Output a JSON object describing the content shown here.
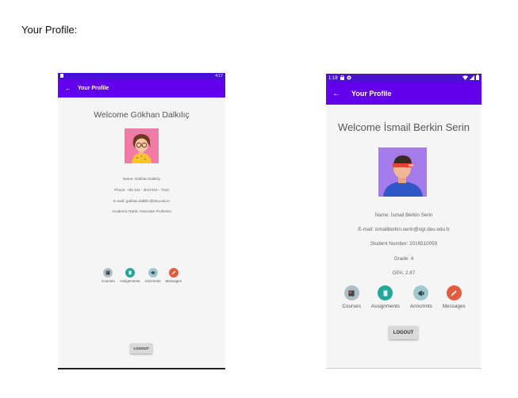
{
  "page": {
    "heading": "Your Profile:"
  },
  "phone1": {
    "status": {
      "left_icon": "sim-icon",
      "time": "4:17"
    },
    "appbar": {
      "back": "←",
      "title": "Your Profile"
    },
    "welcome": "Welcome Gökhan Dalkılıç",
    "avatar": {
      "name": "teacher-avatar",
      "bg": "#f17aa6"
    },
    "info": [
      "Name: Gökhan Dalkılıç",
      "Phone: +90 232 - 3017410 - 7410",
      "E-mail: gokhan.dalkilic@deu.edu.tr",
      "Academic Rank: Associate Professor"
    ],
    "nav": [
      {
        "label": "Courses",
        "icon": "courses-icon",
        "color": "#37474f"
      },
      {
        "label": "Assignments",
        "icon": "assignments-icon",
        "color": "#26a69a"
      },
      {
        "label": "Anncmnts",
        "icon": "announcements-icon",
        "color": "#4a6b73"
      },
      {
        "label": "Messages",
        "icon": "messages-icon",
        "color": "#e25d3f"
      }
    ],
    "logout": "LOGOUT"
  },
  "phone2": {
    "status": {
      "time": "1:18",
      "left_icons": "lock-icon settings-icon",
      "right_icons": "wifi-icon signal-icon battery-icon"
    },
    "appbar": {
      "back": "←",
      "title": "Your Profile"
    },
    "welcome": "Welcome İsmail Berkin Serin",
    "avatar": {
      "name": "student-avatar",
      "bg": "#a67bea"
    },
    "info": [
      "Name: İsmail Berkin Serin",
      "E-mail: ismailberkin.serin@ogr.deu.edu.tr",
      "Student Number: 2016510059",
      "Grade: 4",
      "GPA: 2.87"
    ],
    "nav": [
      {
        "label": "Courses",
        "icon": "courses-icon",
        "color": "#37474f"
      },
      {
        "label": "Assignments",
        "icon": "assignments-icon",
        "color": "#26a69a"
      },
      {
        "label": "Anncmnts",
        "icon": "announcements-icon",
        "color": "#4a6b73"
      },
      {
        "label": "Messages",
        "icon": "messages-icon",
        "color": "#e25d3f"
      }
    ],
    "logout": "LOGOUT"
  }
}
